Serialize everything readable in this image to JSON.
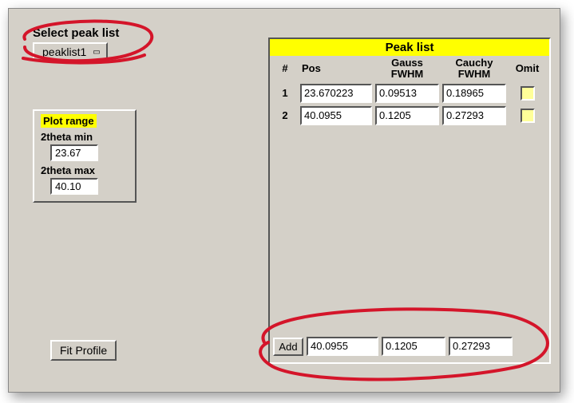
{
  "select": {
    "label": "Select peak list",
    "value": "peaklist1"
  },
  "plot_range": {
    "title": "Plot range",
    "min_label": "2theta min",
    "min_value": "23.67",
    "max_label": "2theta max",
    "max_value": "40.10"
  },
  "fit_button": "Fit Profile",
  "peak_list": {
    "title": "Peak list",
    "headers": {
      "num": "#",
      "pos": "Pos",
      "gauss": "Gauss FWHM",
      "cauchy": "Cauchy FWHM",
      "omit": "Omit"
    },
    "rows": [
      {
        "num": "1",
        "pos": "23.670223",
        "gauss": "0.09513",
        "cauchy": "0.18965"
      },
      {
        "num": "2",
        "pos": "40.0955",
        "gauss": "0.1205",
        "cauchy": "0.27293"
      }
    ],
    "add": {
      "label": "Add",
      "pos": "40.0955",
      "gauss": "0.1205",
      "cauchy": "0.27293"
    }
  }
}
